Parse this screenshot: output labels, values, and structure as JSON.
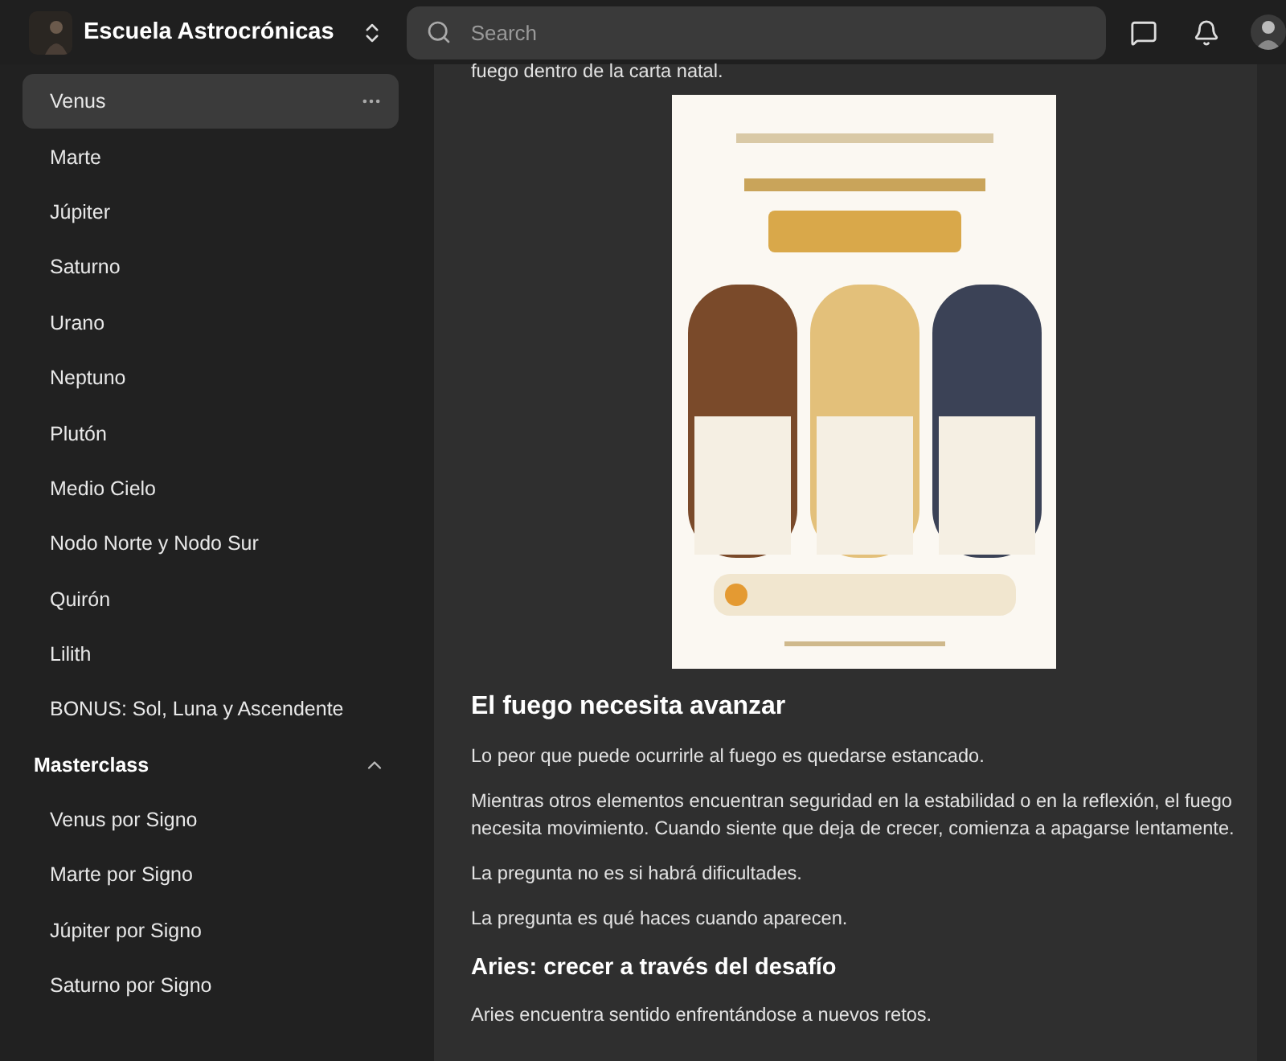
{
  "header": {
    "title": "Escuela Astrocrónicas",
    "search": {
      "placeholder": "Search"
    }
  },
  "sidebar": {
    "items": [
      {
        "label": "Venus",
        "selected": true
      },
      {
        "label": "Marte",
        "selected": false
      },
      {
        "label": "Júpiter",
        "selected": false
      },
      {
        "label": "Saturno",
        "selected": false
      },
      {
        "label": "Urano",
        "selected": false
      },
      {
        "label": "Neptuno",
        "selected": false
      },
      {
        "label": "Plutón",
        "selected": false
      },
      {
        "label": "Medio Cielo",
        "selected": false
      },
      {
        "label": "Nodo Norte y Nodo Sur",
        "selected": false
      },
      {
        "label": "Quirón",
        "selected": false
      },
      {
        "label": "Lilith",
        "selected": false
      },
      {
        "label": "BONUS: Sol, Luna y Ascendente",
        "selected": false
      }
    ],
    "sections": [
      {
        "title": "Masterclass",
        "expanded": true,
        "items": [
          {
            "label": "Venus por Signo",
            "selected": false
          },
          {
            "label": "Marte por Signo",
            "selected": false
          },
          {
            "label": "Júpiter por Signo",
            "selected": false
          },
          {
            "label": "Saturno por Signo",
            "selected": false
          }
        ]
      }
    ]
  },
  "article": [
    {
      "kind": "paragraph",
      "text": "fuego dentro de la carta natal."
    },
    {
      "kind": "picture"
    },
    {
      "kind": "heading",
      "text": "El fuego necesita avanzar"
    },
    {
      "kind": "paragraph",
      "text": "Lo peor que puede ocurrirle al fuego es quedarse estancado."
    },
    {
      "kind": "paragraph",
      "text": "Mientras otros elementos encuentran seguridad en la estabilidad o en la reflexión, el fuego necesita movimiento. Cuando siente que deja de crecer, comienza a apagarse lentamente."
    },
    {
      "kind": "paragraph",
      "text": "La pregunta no es si habrá dificultades."
    },
    {
      "kind": "paragraph",
      "text": "La pregunta es qué haces cuando aparecen."
    },
    {
      "kind": "subheading",
      "text": "Aries: crecer a través del desafío"
    },
    {
      "kind": "paragraph",
      "text": "Aries encuentra sentido enfrentándose a nuevos retos."
    }
  ]
}
